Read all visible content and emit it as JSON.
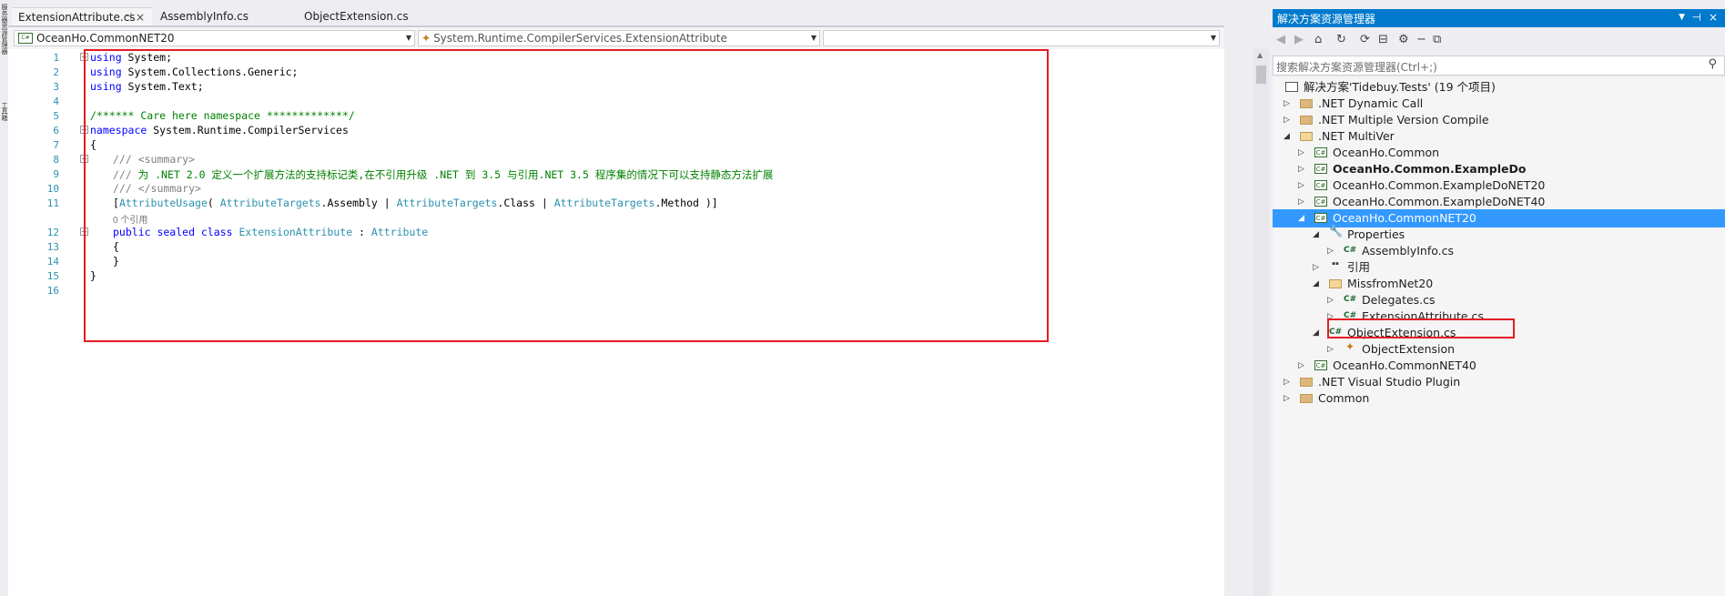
{
  "left_strip": {
    "text_1": "服务器资源管理器",
    "text_2": "工具箱"
  },
  "tabs": [
    {
      "label": "ExtensionAttribute.cs",
      "active": true
    },
    {
      "label": "AssemblyInfo.cs",
      "active": false
    },
    {
      "label": "ObjectExtension.cs",
      "active": false
    }
  ],
  "navbar": {
    "project": "OceanHo.CommonNET20",
    "type": "System.Runtime.CompilerServices.ExtensionAttribute",
    "member": ""
  },
  "editor": {
    "line_numbers": [
      "1",
      "2",
      "3",
      "4",
      "5",
      "6",
      "7",
      "8",
      "9",
      "10",
      "11",
      "12",
      "13",
      "14",
      "15",
      "16"
    ],
    "lines": {
      "l1_kw": "using",
      "l1_rest": " System;",
      "l2_kw": "using",
      "l2_rest": " System.Collections.Generic;",
      "l3_kw": "using",
      "l3_rest": " System.Text;",
      "l5": "/****** Care here namespace *************/",
      "l6_kw": "namespace",
      "l6_rest": " System.Runtime.CompilerServices",
      "l7": "{",
      "l8_a": "/// ",
      "l8_b": "<summary>",
      "l9_a": "/// ",
      "l9_b": "为 .NET 2.0 定义一个扩展方法的支持标记类,在不引用升级 .NET 到 3.5 与引用.NET 3.5 程序集的情况下可以支持静态方法扩展",
      "l10_a": "/// ",
      "l10_b": "</summary>",
      "l11_open": "[",
      "l11_t1": "AttributeUsage",
      "l11_p1": "( ",
      "l11_t2": "AttributeTargets",
      "l11_p2": ".Assembly | ",
      "l11_t3": "AttributeTargets",
      "l11_p3": ".Class | ",
      "l11_t4": "AttributeTargets",
      "l11_p4": ".Method )]",
      "ref_count": "0 个引用",
      "l12_kw": "public sealed class",
      "l12_sp": " ",
      "l12_t1": "ExtensionAttribute",
      "l12_mid": " : ",
      "l12_t2": "Attribute",
      "l13": "{",
      "l14": "}",
      "l15": "}"
    }
  },
  "solution_explorer": {
    "title": "解决方案资源管理器",
    "search_placeholder": "搜索解决方案资源管理器(Ctrl+;)",
    "toolbar_icons": [
      "back-icon",
      "forward-icon",
      "home-icon",
      "history-icon",
      "refresh-icon",
      "collapse-icon",
      "properties-icon",
      "pending-changes-icon",
      "preview-icon"
    ],
    "items": [
      {
        "label": "解决方案'Tidebuy.Tests' (19 个项目)",
        "icon": "solution-icon",
        "indent": 0
      },
      {
        "label": ".NET Dynamic Call",
        "icon": "folder-icon",
        "indent": 0
      },
      {
        "label": ".NET Multiple Version Compile",
        "icon": "folder-icon",
        "indent": 0
      },
      {
        "label": ".NET MultiVer",
        "icon": "folder-open-icon",
        "indent": 0
      },
      {
        "label": "OceanHo.Common",
        "icon": "csproj-icon",
        "indent": 1
      },
      {
        "label": "OceanHo.Common.ExampleDo",
        "icon": "csproj-icon",
        "indent": 1
      },
      {
        "label": "OceanHo.Common.ExampleDoNET20",
        "icon": "csproj-icon",
        "indent": 1
      },
      {
        "label": "OceanHo.Common.ExampleDoNET40",
        "icon": "csproj-icon",
        "indent": 1
      },
      {
        "label": "OceanHo.CommonNET20",
        "icon": "csproj-icon",
        "indent": 1
      },
      {
        "label": "Properties",
        "icon": "wrench-icon",
        "indent": 2
      },
      {
        "label": "AssemblyInfo.cs",
        "icon": "cs-file-icon",
        "indent": 3
      },
      {
        "label": "引用",
        "icon": "references-icon",
        "indent": 2
      },
      {
        "label": "MissfromNet20",
        "icon": "folder-open-icon",
        "indent": 2
      },
      {
        "label": "Delegates.cs",
        "icon": "cs-file-icon",
        "indent": 3
      },
      {
        "label": "ExtensionAttribute.cs",
        "icon": "cs-file-icon",
        "indent": 3
      },
      {
        "label": "ObjectExtension.cs",
        "icon": "cs-file-icon",
        "indent": 2
      },
      {
        "label": "ObjectExtension",
        "icon": "class-icon",
        "indent": 3
      },
      {
        "label": "OceanHo.CommonNET40",
        "icon": "csproj-icon",
        "indent": 1
      },
      {
        "label": ".NET Visual Studio Plugin",
        "icon": "folder-icon",
        "indent": 0
      },
      {
        "label": "Common",
        "icon": "folder-icon",
        "indent": 0
      }
    ]
  },
  "colors": {
    "accent": "#007acc",
    "selection": "#3399ff",
    "highlight_box": "#e51c23"
  }
}
